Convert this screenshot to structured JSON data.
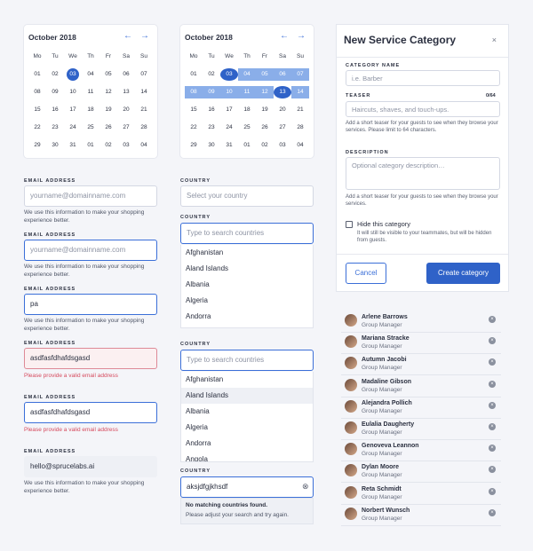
{
  "calendar1": {
    "month": "October 2018",
    "prev": "←",
    "next": "→",
    "dow": [
      "Mo",
      "Tu",
      "We",
      "Th",
      "Fr",
      "Sa",
      "Su"
    ],
    "weeks": [
      [
        "01",
        "02",
        "03",
        "04",
        "05",
        "06",
        "07"
      ],
      [
        "08",
        "09",
        "10",
        "11",
        "12",
        "13",
        "14"
      ],
      [
        "15",
        "16",
        "17",
        "18",
        "19",
        "20",
        "21"
      ],
      [
        "22",
        "23",
        "24",
        "25",
        "26",
        "27",
        "28"
      ],
      [
        "29",
        "30",
        "31",
        "01",
        "02",
        "03",
        "04"
      ]
    ]
  },
  "calendar2": {
    "month": "October 2018",
    "prev": "←",
    "next": "→",
    "dow": [
      "Mo",
      "Tu",
      "We",
      "Th",
      "Fr",
      "Sa",
      "Su"
    ],
    "weeks": [
      [
        "01",
        "02",
        "03",
        "04",
        "05",
        "06",
        "07"
      ],
      [
        "08",
        "09",
        "10",
        "11",
        "12",
        "13",
        "14"
      ],
      [
        "15",
        "16",
        "17",
        "18",
        "19",
        "20",
        "21"
      ],
      [
        "22",
        "23",
        "24",
        "25",
        "26",
        "27",
        "28"
      ],
      [
        "29",
        "30",
        "31",
        "01",
        "02",
        "03",
        "04"
      ]
    ]
  },
  "email": {
    "label": "EMAIL ADDRESS",
    "placeholder": "yourname@domainname.com",
    "help": "We use this information to make your shopping experience better.",
    "typed": "pa",
    "invalid": "asdfasfdhafdsgasd",
    "error": "Please provide a valid email address",
    "filled": "hello@sprucelabs.ai"
  },
  "country": {
    "label": "COUNTRY",
    "select_placeholder": "Select your country",
    "search_placeholder": "Type to search countries",
    "options": [
      "Afghanistan",
      "Aland Islands",
      "Albania",
      "Algeria",
      "Andorra",
      "Angola"
    ],
    "query": "aksjdfgjkhsdf",
    "clear": "⊗",
    "no_match_title": "No matching countries found.",
    "no_match_help": "Please adjust your search and try again."
  },
  "panel": {
    "title": "New Service Category",
    "close": "×",
    "name_label": "CATEGORY NAME",
    "name_placeholder": "i.e. Barber",
    "teaser_label": "TEASER",
    "teaser_count": "0/64",
    "teaser_placeholder": "Haircuts, shaves, and touch-ups.",
    "teaser_help": "Add a short teaser for your guests to see when they browse your services. Please limit to 64 characters.",
    "desc_label": "DESCRIPTION",
    "desc_placeholder": "Optional category description…",
    "desc_help": "Add a short teaser for your guests to see when they browse your services.",
    "hide_label": "Hide this category",
    "hide_help": "It will still be visible to your teammates, but will be hidden from guests.",
    "cancel": "Cancel",
    "create": "Create category"
  },
  "people": [
    {
      "name": "Arlene Barrows",
      "role": "Group Manager"
    },
    {
      "name": "Mariana Stracke",
      "role": "Group Manager"
    },
    {
      "name": "Autumn Jacobi",
      "role": "Group Manager"
    },
    {
      "name": "Madaline Gibson",
      "role": "Group Manager"
    },
    {
      "name": "Alejandra Pollich",
      "role": "Group Manager"
    },
    {
      "name": "Eulalia Daugherty",
      "role": "Group Manager"
    },
    {
      "name": "Genoveva Leannon",
      "role": "Group Manager"
    },
    {
      "name": "Dylan Moore",
      "role": "Group Manager"
    },
    {
      "name": "Reta Schmidt",
      "role": "Group Manager"
    },
    {
      "name": "Norbert Wunsch",
      "role": "Group Manager"
    }
  ],
  "remove_glyph": "×"
}
